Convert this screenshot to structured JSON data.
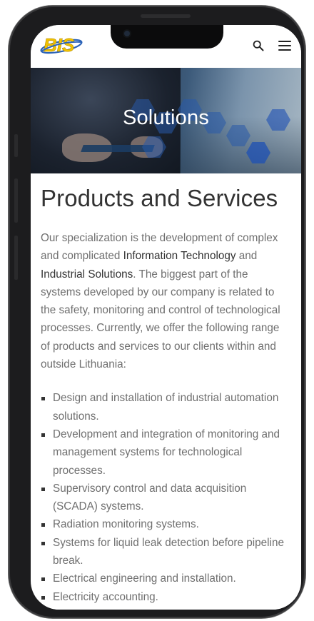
{
  "header": {
    "logo_text": "BIS",
    "search_icon": "search-icon",
    "menu_icon": "hamburger-menu-icon"
  },
  "hero": {
    "title": "Solutions"
  },
  "main": {
    "title": "Products and Services",
    "intro": {
      "part1": "Our specialization is the development of complex and complicated ",
      "highlight1": "Information Technology",
      "part2": " and ",
      "highlight2": "Industrial Solutions",
      "part3": ". The biggest part of the systems developed by our company is related to the safety, monitoring and control of technological processes. Currently, we offer the following range of products and services to our clients within and outside Lithuania:"
    },
    "services": [
      "Design and installation of industrial automation solutions.",
      "Development and integration of monitoring and management systems for technological processes.",
      "Supervisory control and data acquisition (SCADA) systems.",
      "Radiation monitoring systems.",
      "Systems for liquid leak detection before pipeline break.",
      "Electrical engineering and installation.",
      "Electricity accounting."
    ]
  },
  "colors": {
    "logo_yellow": "#f2c200",
    "logo_blue": "#2b63b8",
    "text_dark": "#333333",
    "text_body": "#6f6f6f"
  }
}
